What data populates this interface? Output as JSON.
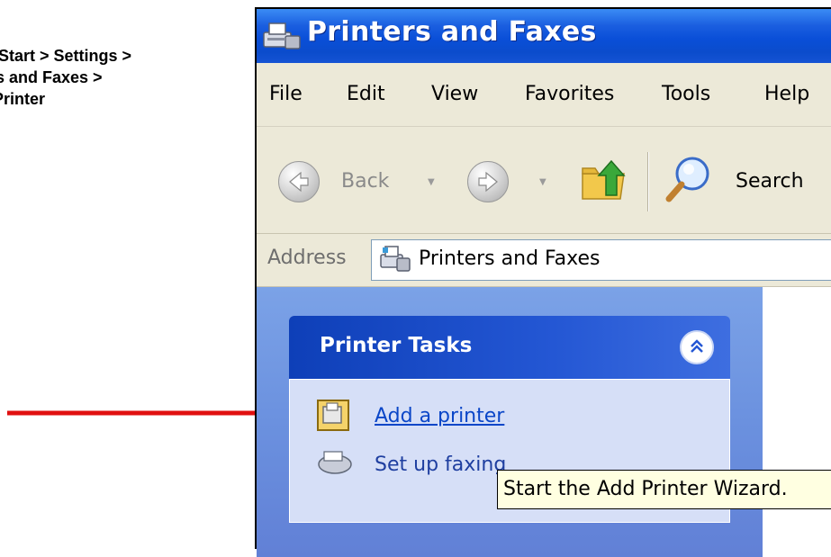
{
  "instructions": {
    "line1": "Start > Settings >",
    "line2": "rs and Faxes >",
    "line3": "Printer"
  },
  "window": {
    "title": "Printers and Faxes",
    "menu": [
      "File",
      "Edit",
      "View",
      "Favorites",
      "Tools",
      "Help"
    ],
    "toolbar": {
      "back_label": "Back",
      "search_label": "Search"
    },
    "address": {
      "label": "Address",
      "value": "Printers and Faxes"
    }
  },
  "printer_tasks": {
    "title": "Printer Tasks",
    "items": [
      {
        "label": "Add a printer",
        "icon": "add-printer-icon"
      },
      {
        "label": "Set up faxing",
        "icon": "fax-icon"
      }
    ]
  },
  "tooltip": {
    "text": "Start the Add Printer Wizard."
  },
  "colors": {
    "arrow": "#e01010",
    "titlebar": "#0a4fd8",
    "task_header": "#0e3fb8",
    "link": "#0a46c8",
    "tooltip_bg": "#ffffe1"
  }
}
